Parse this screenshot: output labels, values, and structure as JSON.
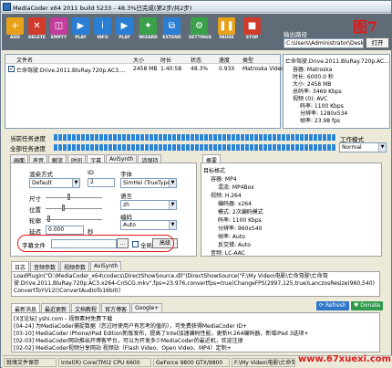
{
  "window": {
    "title": "MediaCoder x64 2011 build 5233 - 48.3%已完成(第2步/共2步)"
  },
  "annotation": {
    "figure_label": "图7"
  },
  "toolbar": {
    "buttons": [
      {
        "label": "ADD",
        "icon": "add-icon",
        "color": "#e8a21a"
      },
      {
        "label": "DELETE",
        "icon": "delete-icon",
        "color": "#d13b2b"
      },
      {
        "label": "EMPTY",
        "icon": "empty-icon",
        "color": "#c43c9c"
      },
      {
        "label": "PLAY",
        "icon": "play-icon",
        "color": "#2a7fd4"
      },
      {
        "label": "INFO",
        "icon": "info-icon",
        "color": "#2a7fd4"
      },
      {
        "label": "PLAY",
        "icon": "play-icon",
        "color": "#2a7fd4"
      },
      {
        "label": "WIZARD",
        "icon": "wizard-icon",
        "color": "#3aa04a"
      },
      {
        "label": "EXTEND",
        "icon": "extend-icon",
        "color": "#2a7fd4"
      },
      {
        "label": "SETTINGS",
        "icon": "settings-icon",
        "color": "#3aa04a"
      },
      {
        "label": "PAUSE",
        "icon": "pause-icon",
        "color": "#e8a21a"
      },
      {
        "label": "STOP",
        "icon": "stop-icon",
        "color": "#d13b2b"
      }
    ],
    "output_label": "输出路径",
    "output_path": "C:\\Users\\Administrator\\Desk",
    "open_label": "打开"
  },
  "file_list": {
    "headers": [
      "文件名",
      "大小",
      "时长",
      "状态",
      "速度",
      "类型"
    ],
    "rows": [
      {
        "checked": true,
        "name": "亡命驾驶.Drive.2011.BluRay.720p.AC3....",
        "size": "2458 MB",
        "duration": "1:40:58",
        "status": "48.3%",
        "speed": "0.93X",
        "type": "Matroska Video"
      }
    ]
  },
  "properties": {
    "lines": [
      "亡命驾驶.Drive.2011.BluRay.720p.AC...",
      "容器: Matroska",
      "时长: 6000.0 秒",
      "大小: 2458 MB",
      "总码率: 3469 Kbps",
      "视频 (0): AVC",
      "码率: 1100 Kbps",
      "分辨率: 1280x534",
      "帧率: 23.98 fps"
    ]
  },
  "progress": {
    "current_label": "当前任务进度",
    "current_fraction": 0.48,
    "total_label": "全部任务进度",
    "total_fraction": 0.48,
    "working_label": "工作模式",
    "priority_value": "Normal"
  },
  "settings_tabs": {
    "items": [
      "画面",
      "声音",
      "解流",
      "时间",
      "字幕",
      "AviSynth",
      "流保持"
    ],
    "active": "字幕",
    "right_tab": "概要"
  },
  "subtitle": {
    "render_label": "渲染方式",
    "render_value": "Default",
    "id_label": "ID",
    "id_value": "2",
    "font_label": "字体",
    "font_value": "SimHei (TrueType)",
    "size_label": "尺寸",
    "pos_label": "位置",
    "outline_label": "轮廓",
    "delay_label": "延迟",
    "delay_value": "0.000",
    "delay_unit": "秒",
    "lang_label": "语言",
    "lang_value": "zh",
    "encoding_label": "编码",
    "encoding_value": "Auto",
    "file_label": "字幕文件",
    "browse_label": "...",
    "fullscreen_label": "全局",
    "advanced_label": "高级"
  },
  "summary": {
    "lines": [
      "目标格式",
      "容器: MP4",
      "混流: MP4Box",
      "视频: H.264",
      "编码器: x264",
      "模式: 2次编码模式",
      "码率: 1100 Kbps",
      "分辨率: 960x540",
      "帧率: Auto",
      "反交错: Auto",
      "音频: LC-AAC"
    ]
  },
  "log_tabs": {
    "items": [
      "日志",
      "音频参数",
      "视频参数",
      "AviSynth"
    ],
    "active": "日志"
  },
  "log_text": "LoadPlugin(\"D:\\MediaCoder_x64\\codecs\\DirectShowSource.dll\")DirectShowSource(\"F:\\My Video\\电影\\亡命驾驶\\亡命驾驶.Drive.2011.BluRay.720p.AC3.x264-CnSCG.mkv\",fps=23.976,convertfps=true)ChangeFPS(2997,125,true)LanczosResize(960,540) ConvertToYV12()ConvertAudioTo16bit()",
  "news_tabs": {
    "items": [
      "最新消息",
      "最近更新",
      "文档教程",
      "官方博客",
      "Google+"
    ],
    "active": "最新消息",
    "refresh_label": "Refresh",
    "donate_label": "Donate"
  },
  "news": [
    "[X][论坛] yshi.com - 视频素材免费下载",
    "[04-24] 为MediaCoder捕捉数据（您过时使用户有您考的值的），可免费获得MediaCoder ID+",
    "[03-10] MediaCoder iPhone/iPad Edition新版发布，提高了Intel加速编码性能，更新H.264编码器，新增iPad 3选项+",
    "[02-03] MediaCoder网站推出开博客平台，可以为开发多少MediaCoder的最近机，欢迎注册",
    "[02-02] MediaCoder视频分享网站 视频站（Flash Video、Open Video、MP4）定制+"
  ],
  "status": {
    "ready": "就绪文件保存",
    "cpu": "Intel(R) Core(TM)2 CPU 6600",
    "gpu": "GeForce 9800 GTX/9800",
    "path": "F:\\My Video\\电影\\亡命驾驶"
  },
  "watermark": "www.67xuexi.com"
}
